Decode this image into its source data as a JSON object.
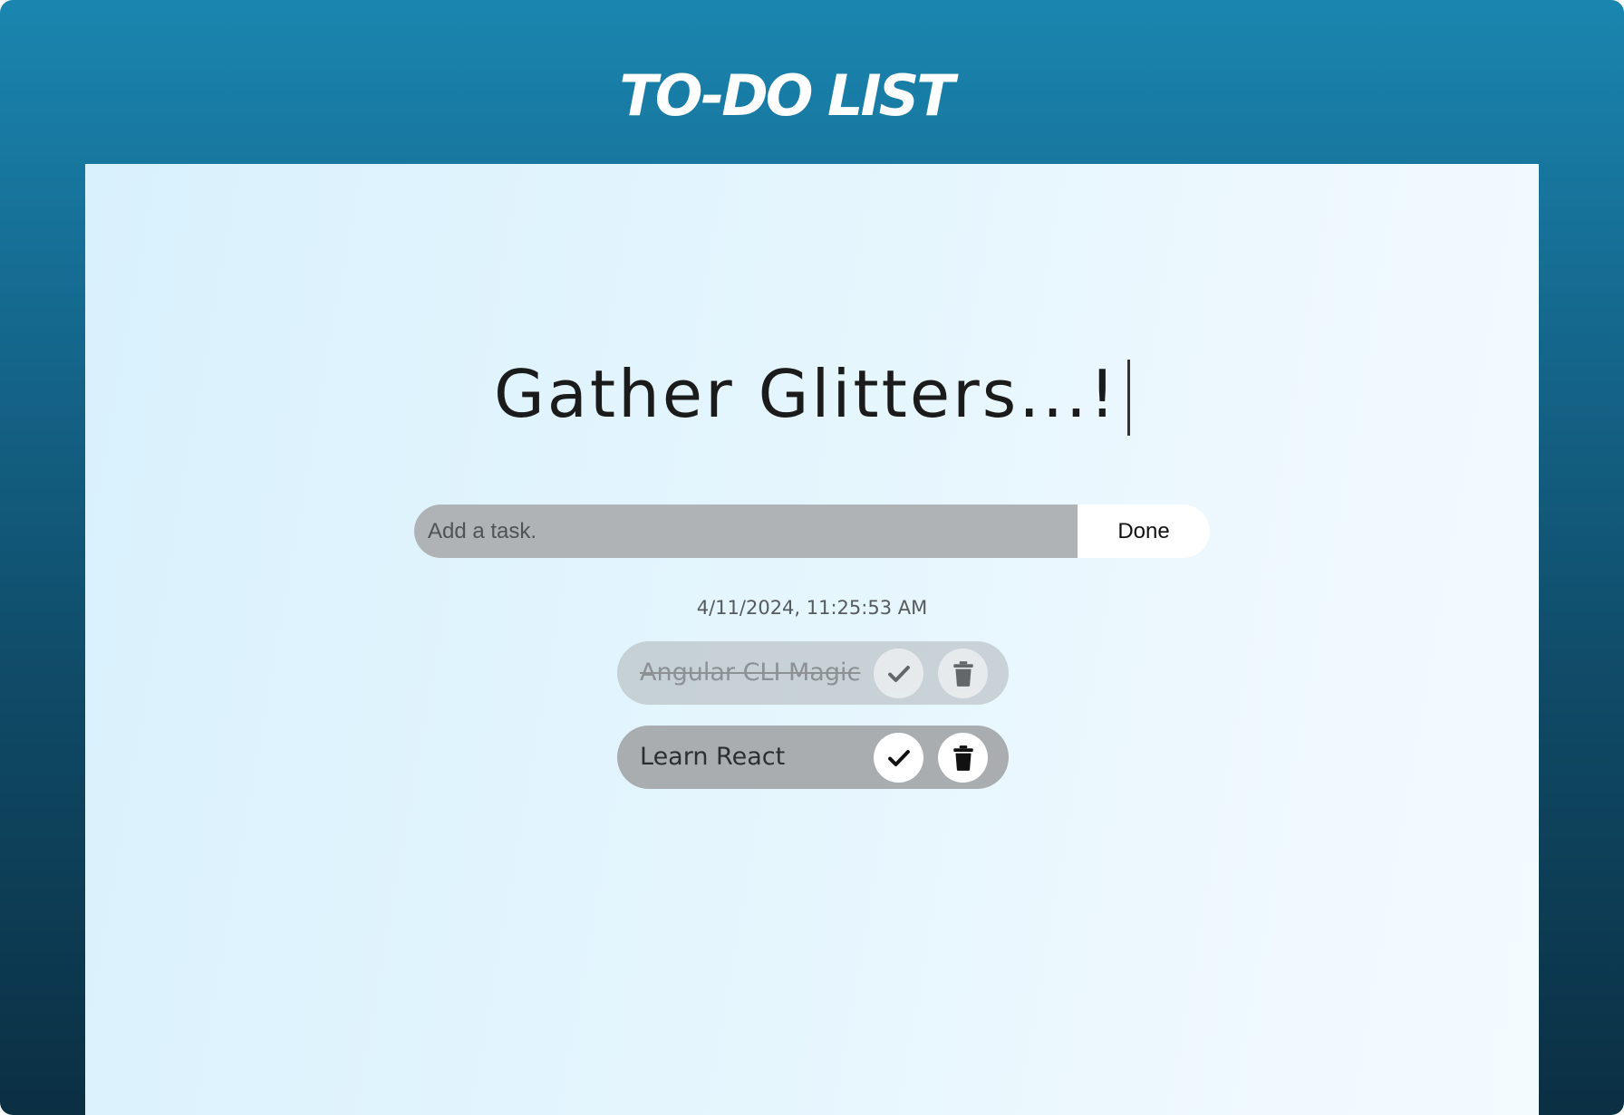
{
  "header": {
    "title": "TO-DO LIST"
  },
  "headline": {
    "text": "Gather Glitters...!"
  },
  "task_form": {
    "placeholder": "Add a task.",
    "value": "",
    "submit_label": "Done"
  },
  "timestamp": "4/11/2024, 11:25:53 AM",
  "tasks": [
    {
      "text": "Angular CLI Magic",
      "completed": true,
      "complete_icon": "check-icon",
      "delete_icon": "trash-icon"
    },
    {
      "text": "Learn React",
      "completed": false,
      "complete_icon": "check-icon",
      "delete_icon": "trash-icon"
    }
  ],
  "colors": {
    "header_gradient_top": "#1a86b0",
    "header_gradient_bottom": "#0b2f43",
    "panel_background": "#e4f5fd",
    "input_background": "#b0b3b6",
    "task_background": "#a9adb0",
    "button_background": "#ffffff"
  }
}
